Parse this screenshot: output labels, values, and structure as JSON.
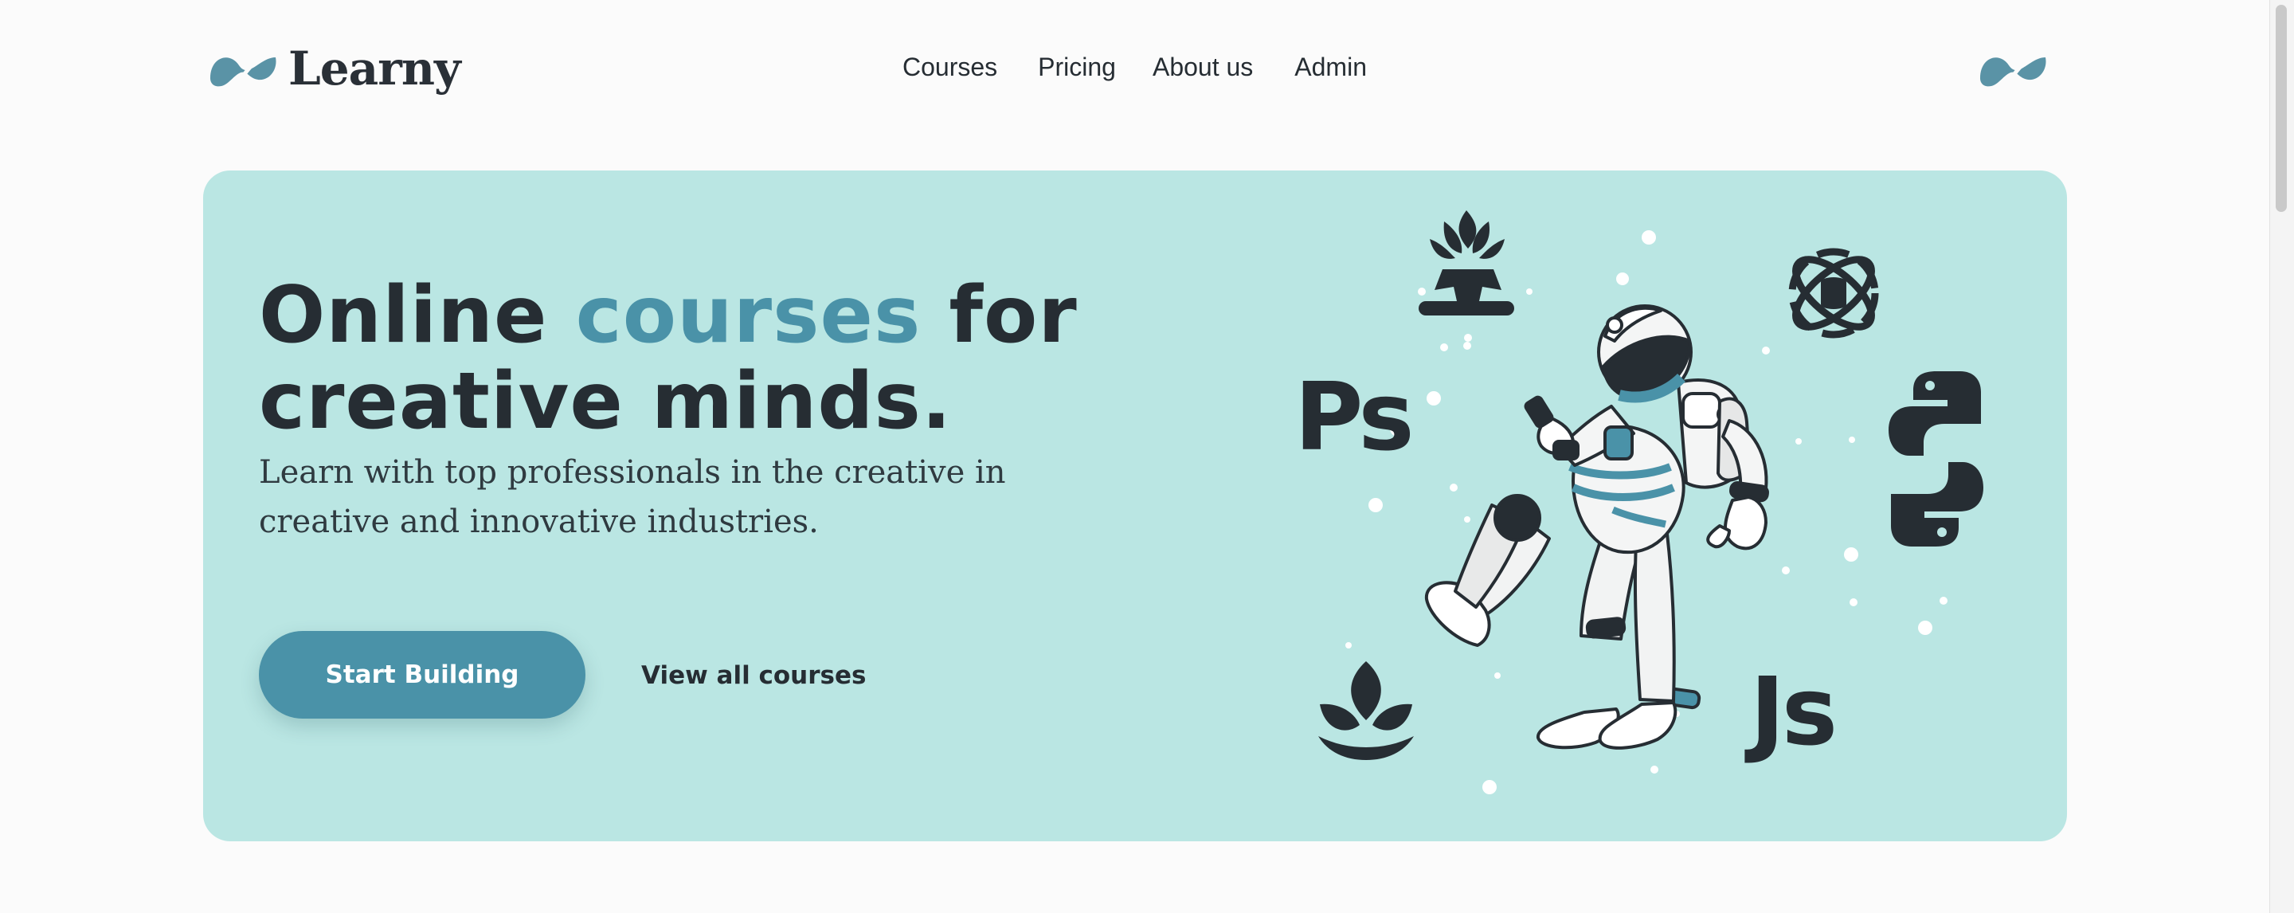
{
  "brand": {
    "name": "Learny",
    "logo_icon": "wave-logo-icon",
    "accent": "#4a92a8",
    "hero_bg": "#bae6e3"
  },
  "nav": {
    "items": [
      "Courses",
      "Pricing",
      "About us",
      "Admin"
    ]
  },
  "hero": {
    "headline_part1": "Online",
    "headline_accent": "courses",
    "headline_part2": "for",
    "headline_line2": "creative minds.",
    "subtitle": "Learn with top professionals in the creative  in creative and innovative industries.",
    "primary_cta": "Start Building",
    "secondary_cta": "View all courses"
  },
  "illustration": {
    "labels": {
      "photoshop": "Ps",
      "javascript": "Js"
    },
    "icons": [
      "meditation-icon",
      "data-science-icon",
      "python-icon",
      "lotus-icon",
      "astronaut-illustration"
    ]
  }
}
